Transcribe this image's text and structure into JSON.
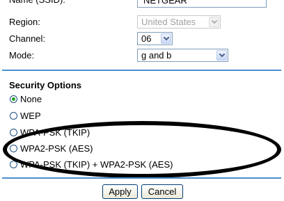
{
  "name_label": "Name (SSID):",
  "ssid_value": "NETGEAR",
  "region": {
    "label": "Region:",
    "value": "United States"
  },
  "channel": {
    "label": "Channel:",
    "value": "06"
  },
  "mode": {
    "label": "Mode:",
    "value": "g and b"
  },
  "security": {
    "title": "Security Options",
    "options": [
      {
        "label": "None",
        "checked": true
      },
      {
        "label": "WEP",
        "checked": false
      },
      {
        "label": "WPA-PSK (TKIP)",
        "checked": false
      },
      {
        "label": "WPA2-PSK (AES)",
        "checked": false
      },
      {
        "label": "WPA-PSK (TKIP) + WPA2-PSK (AES)",
        "checked": false
      }
    ]
  },
  "buttons": {
    "apply": "Apply",
    "cancel": "Cancel"
  },
  "colors": {
    "divider": "#4a8fd0",
    "radio_checked": "#21a121",
    "annotation": "#000000"
  }
}
